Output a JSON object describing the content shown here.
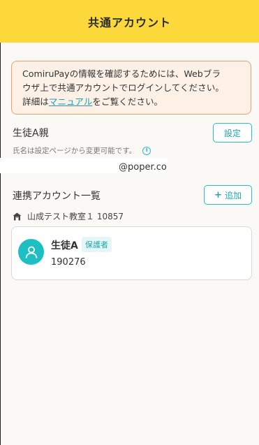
{
  "header": {
    "title": "共通アカウント"
  },
  "notice": {
    "line1": "ComiruPayの情報を確認するためには、Webブラ",
    "line2": "ウザ上で共通アカウントでログインしてください。",
    "line3_prefix": "詳細は",
    "link_label": "マニュアル",
    "line3_suffix": "をご覧ください。"
  },
  "profile": {
    "name": "生徒A親",
    "settings_label": "設定",
    "hint": "氏名は設定ページから変更可能です。",
    "email": "@poper.co"
  },
  "linked": {
    "title": "連携アカウント一覧",
    "add_label": "追加",
    "school": "山成テスト教室１ 10857",
    "account": {
      "name": "生徒A",
      "role": "保護者",
      "id": "190276"
    }
  },
  "icons": [
    "info-icon",
    "plus-icon",
    "school-icon",
    "person-icon"
  ],
  "colors": {
    "header": "#fcd83b",
    "accent": "#2cbcc4",
    "notice_border": "#f1a067"
  }
}
